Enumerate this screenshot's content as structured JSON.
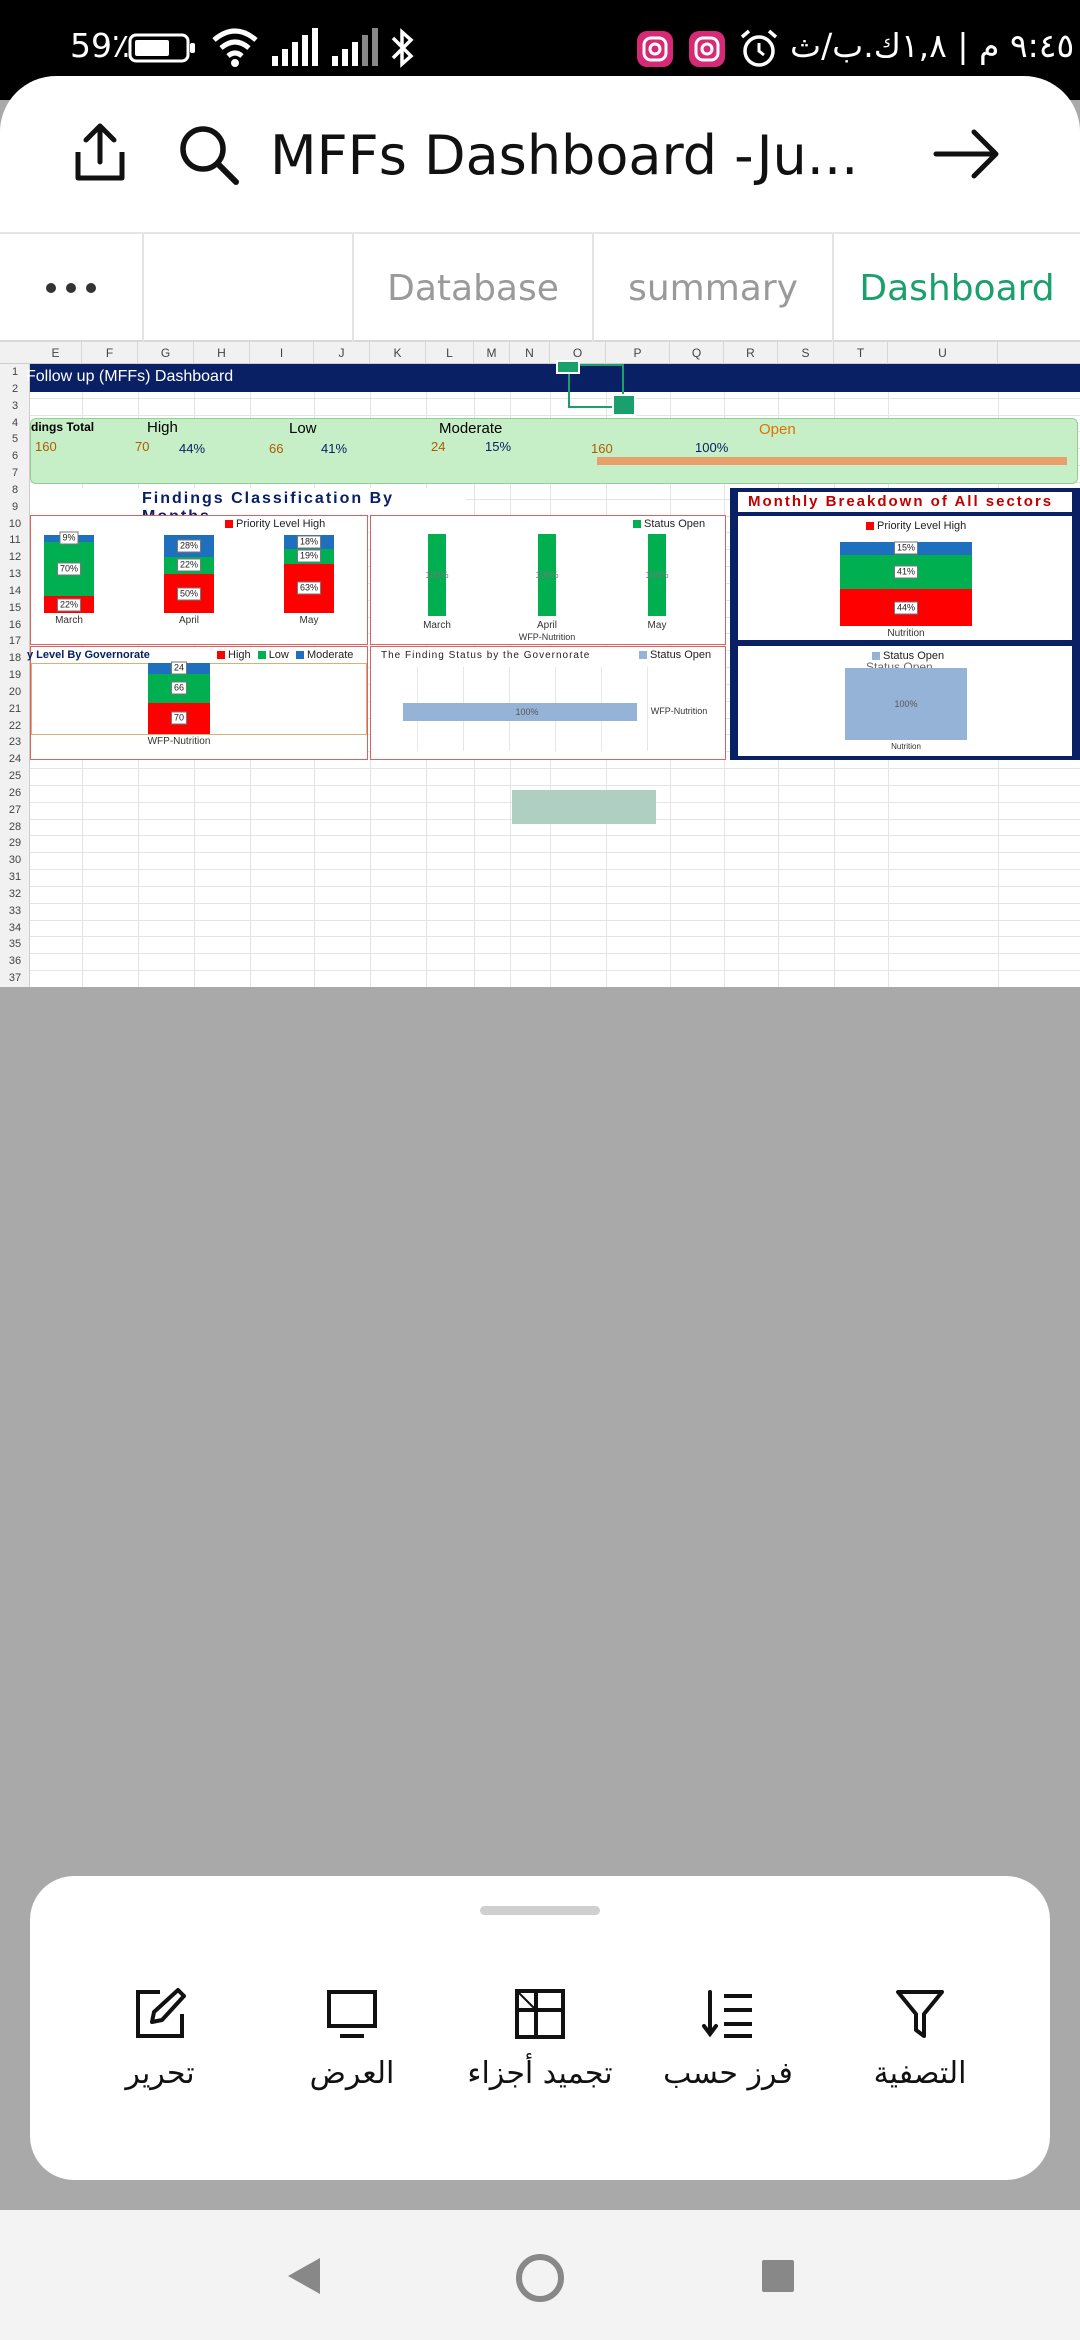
{
  "status_bar": {
    "battery": "59٪",
    "time_date": "٩:٤٥ م | ١,٨ك.ب/ث"
  },
  "header": {
    "title": "MFFs Dashboard -Ju..."
  },
  "tabs": [
    {
      "label": "Database",
      "active": false
    },
    {
      "label": "summary",
      "active": false
    },
    {
      "label": "Dashboard",
      "active": true
    }
  ],
  "sheet": {
    "columns": [
      "E",
      "F",
      "G",
      "H",
      "I",
      "J",
      "K",
      "L",
      "M",
      "N",
      "O",
      "P",
      "Q",
      "R",
      "S",
      "T",
      "U"
    ],
    "rows": [
      "1",
      "2",
      "3",
      "4",
      "5",
      "6",
      "7",
      "8",
      "9",
      "10",
      "11",
      "12",
      "13",
      "14",
      "15",
      "16",
      "17",
      "18",
      "19",
      "20",
      "21",
      "22",
      "23",
      "24",
      "25",
      "26",
      "27",
      "28",
      "29",
      "30",
      "31",
      "32",
      "33",
      "34",
      "35",
      "36",
      "37"
    ],
    "title_bar": "Follow up (MFFs)  Dashboard",
    "kpi": {
      "total_label": "dings Total",
      "total_value": "160",
      "high_label": "High",
      "high_count": "70",
      "high_pct": "44%",
      "low_label": "Low",
      "low_count": "66",
      "low_pct": "41%",
      "moderate_label": "Moderate",
      "moderate_count": "24",
      "moderate_pct": "15%",
      "open_label": "Open",
      "open_count": "160",
      "open_pct": "100%"
    }
  },
  "colors": {
    "high": "#ff0000",
    "low": "#00b050",
    "moderate": "#1f6fbf",
    "status_open_green": "#00b050",
    "status_open_blue": "#95b3d7",
    "accent": "#1aa06d",
    "navy": "#0a2064"
  },
  "chart_data": [
    {
      "type": "bar",
      "stacked": true,
      "title": "Findings Classification By Months",
      "legend": "Priority Level High",
      "legend_placement": "top-right",
      "categories": [
        "March",
        "April",
        "May"
      ],
      "series": [
        {
          "values": [
            22,
            50,
            63
          ],
          "labels": [
            "22%",
            "50%",
            "63%"
          ],
          "color": "#ff0000"
        },
        {
          "values": [
            70,
            22,
            19
          ],
          "labels": [
            "70%",
            "22%",
            "19%"
          ],
          "color": "#00b050"
        },
        {
          "values": [
            9,
            28,
            18
          ],
          "labels": [
            "9%",
            "28%",
            "18%"
          ],
          "color": "#1f6fbf"
        }
      ]
    },
    {
      "type": "bar",
      "legend": "Status Open",
      "legend_placement": "top-right",
      "categories": [
        "March",
        "April",
        "May"
      ],
      "values": [
        100,
        100,
        100
      ],
      "labels": [
        "100%",
        "100%",
        "100%"
      ],
      "xlabel": "WFP-Nutrition",
      "color": "#00b050"
    },
    {
      "type": "bar",
      "stacked": true,
      "title": "Monthly Breakdown of All sectors",
      "legend": "Priority Level High",
      "categories": [
        "Nutrition"
      ],
      "series": [
        {
          "values": [
            44
          ],
          "labels": [
            "44%"
          ],
          "color": "#ff0000"
        },
        {
          "values": [
            41
          ],
          "labels": [
            "41%"
          ],
          "color": "#00b050"
        },
        {
          "values": [
            15
          ],
          "labels": [
            "15%"
          ],
          "color": "#1f6fbf"
        }
      ]
    },
    {
      "type": "bar",
      "stacked": true,
      "title": "y Level By Governorate",
      "legend_items": [
        "High",
        "Low",
        "Moderate"
      ],
      "categories": [
        "WFP-Nutrition"
      ],
      "series": [
        {
          "name": "High",
          "values": [
            70
          ],
          "labels": [
            "70"
          ],
          "color": "#ff0000"
        },
        {
          "name": "Low",
          "values": [
            66
          ],
          "labels": [
            "66"
          ],
          "color": "#00b050"
        },
        {
          "name": "Moderate",
          "values": [
            24
          ],
          "labels": [
            "24"
          ],
          "color": "#1f6fbf"
        }
      ]
    },
    {
      "type": "bar",
      "orientation": "horizontal",
      "title": "The Finding Status by the Governorate",
      "legend": "Status Open",
      "categories": [
        "WFP-Nutrition"
      ],
      "values": [
        100
      ],
      "labels": [
        "100%"
      ],
      "color": "#95b3d7"
    },
    {
      "type": "bar",
      "title": "Status Open",
      "legend": "Status Open",
      "categories": [
        "Nutrition"
      ],
      "values": [
        100
      ],
      "labels": [
        "100%"
      ],
      "color": "#95b3d7"
    }
  ],
  "bottom_sheet": {
    "actions": [
      {
        "label": "التصفية",
        "icon": "filter-icon"
      },
      {
        "label": "فرز حسب",
        "icon": "sort-icon"
      },
      {
        "label": "تجميد أجزاء",
        "icon": "freeze-panes-icon"
      },
      {
        "label": "العرض",
        "icon": "display-icon"
      },
      {
        "label": "تحرير",
        "icon": "edit-icon"
      }
    ]
  }
}
